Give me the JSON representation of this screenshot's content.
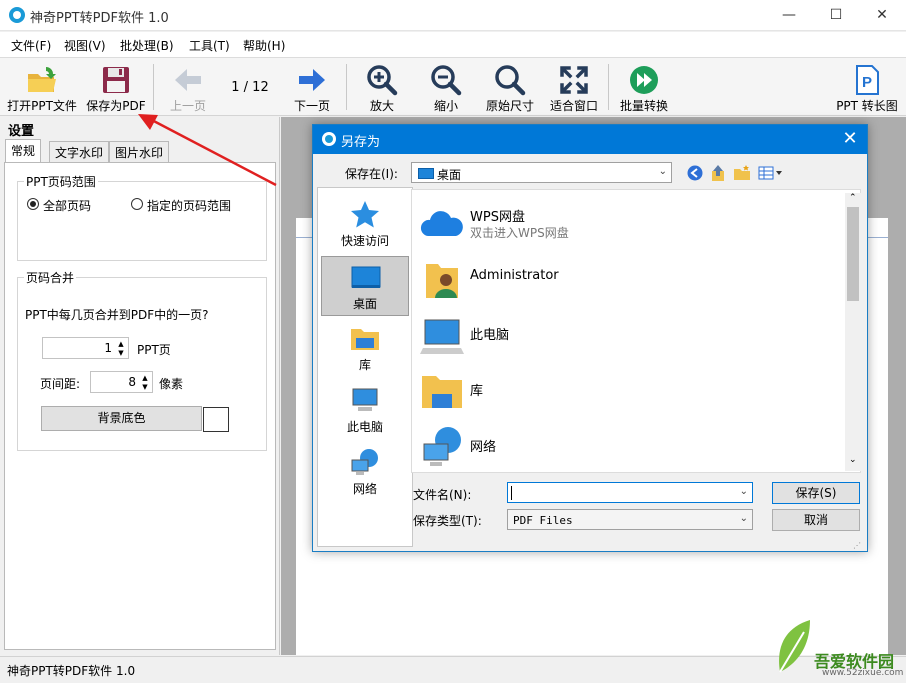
{
  "window": {
    "title": "神奇PPT转PDF软件 1.0",
    "min_glyph": "—",
    "max_glyph": "☐",
    "close_glyph": "✕"
  },
  "menu": {
    "items": [
      "文件(F)",
      "视图(V)",
      "批处理(B)",
      "工具(T)",
      "帮助(H)"
    ]
  },
  "toolbar": {
    "open_label": "打开PPT文件",
    "save_label": "保存为PDF",
    "prev_label": "上一页",
    "page_indicator": "1 / 12",
    "next_label": "下一页",
    "zoom_in_label": "放大",
    "zoom_out_label": "缩小",
    "original_size_label": "原始尺寸",
    "fit_window_label": "适合窗口",
    "batch_label": "批量转换",
    "long_image_label": "PPT 转长图"
  },
  "settings": {
    "title": "设置",
    "tabs": [
      "常规",
      "文字水印",
      "图片水印"
    ],
    "page_range": {
      "legend": "PPT页码范围",
      "option_all": "全部页码",
      "option_custom": "指定的页码范围"
    },
    "merge": {
      "legend": "页码合并",
      "question": "PPT中每几页合并到PDF中的一页?",
      "pages_value": "1",
      "pages_unit": "PPT页",
      "gap_label": "页间距:",
      "gap_value": "8",
      "gap_unit": "像素",
      "bg_color_button": "背景底色",
      "bg_color_swatch": "#ffffff"
    }
  },
  "statusbar": {
    "text": "神奇PPT转PDF软件 1.0"
  },
  "dialog": {
    "title": "另存为",
    "save_in_label": "保存在(I):",
    "save_in_value": "桌面",
    "places": [
      {
        "label": "快速访问",
        "icon": "star-icon"
      },
      {
        "label": "桌面",
        "icon": "desktop-icon"
      },
      {
        "label": "库",
        "icon": "library-folder-icon"
      },
      {
        "label": "此电脑",
        "icon": "computer-icon"
      },
      {
        "label": "网络",
        "icon": "network-icon"
      }
    ],
    "files": [
      {
        "name": "WPS网盘",
        "sub": "双击进入WPS网盘",
        "icon": "cloud-icon"
      },
      {
        "name": "Administrator",
        "sub": "",
        "icon": "user-folder-icon"
      },
      {
        "name": "此电脑",
        "sub": "",
        "icon": "computer-icon"
      },
      {
        "name": "库",
        "sub": "",
        "icon": "library-folder-icon"
      },
      {
        "name": "网络",
        "sub": "",
        "icon": "network-icon"
      }
    ],
    "filename_label": "文件名(N):",
    "filename_value": "",
    "filetype_label": "保存类型(T):",
    "filetype_value": "PDF Files",
    "save_button": "保存(S)",
    "cancel_button": "取消"
  },
  "watermark": {
    "site_name": "吾爱软件园",
    "site_url": "www.52zixue.com"
  },
  "colors": {
    "dialog_titlebar": "#0078d7",
    "annotation_arrow": "#e02020",
    "document_background": "#adadad"
  }
}
